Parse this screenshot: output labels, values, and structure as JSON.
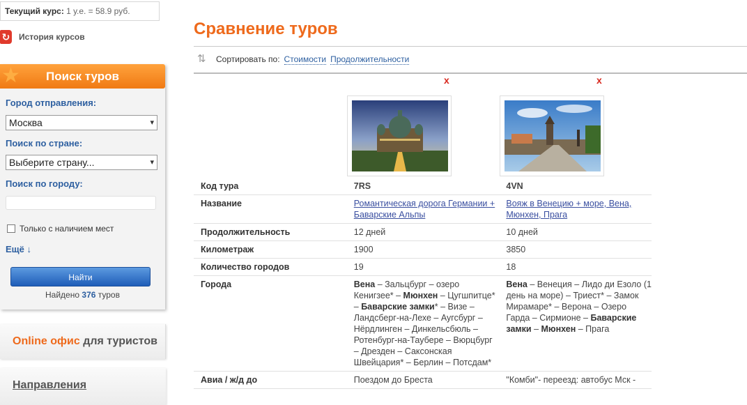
{
  "sidebar": {
    "rate_label": "Текущий курс:",
    "rate_value": "1 у.е. = 58.9 руб.",
    "history_label": "История курсов",
    "search": {
      "title": "Поиск туров",
      "departure_label": "Город отправления:",
      "departure_value": "Москва",
      "country_label": "Поиск по стране:",
      "country_value": "Выберите страну...",
      "city_label": "Поиск по городу:",
      "city_value": "",
      "only_available_label": "Только с наличием мест",
      "more_label": "Ещё ↓",
      "find_button": "Найти",
      "found_prefix": "Найдено",
      "found_count": "376",
      "found_suffix": "туров"
    },
    "online_part1": "Online офис",
    "online_part2": "для туристов",
    "directions_label": "Направления"
  },
  "main": {
    "title": "Сравнение туров",
    "sort_label": "Сортировать по:",
    "sort_options": [
      "Стоимости",
      "Продолжительности"
    ],
    "remove_label": "x",
    "rows": {
      "code": "Код тура",
      "name": "Название",
      "duration": "Продолжительность",
      "mileage": "Километраж",
      "cities_count": "Количество городов",
      "cities": "Города",
      "transport": "Авиа / ж/д до"
    },
    "tours": [
      {
        "code": "7RS",
        "name": "Романтическая дорога Германии + Баварские Альпы",
        "duration": "12 дней",
        "mileage": "1900",
        "cities_count": "19",
        "cities_1b": "Вена",
        "cities_2": " – Зальцбург – озеро Кенигзее* – ",
        "cities_3b": "Мюнхен",
        "cities_4": " – Цугшпитце* – ",
        "cities_5b": "Баварские замки",
        "cities_6": "* – Визе – Ландсберг-на-Лехе – Аугсбург – Нёрдлинген – Динкельсбюль – Ротенбург-на-Таубере – Вюрцбург – Дрезден – Саксонская Швейцария* – Берлин – Потсдам*",
        "transport": "Поездом до Бреста"
      },
      {
        "code": "4VN",
        "name": "Вояж в Венецию + море, Вена, Мюнхен, Прага",
        "duration": "10 дней",
        "mileage": "3850",
        "cities_count": "18",
        "cities_1b": "Вена",
        "cities_2": " – Венеция – Лидо ди Езоло (1 день на море) – Триест* – Замок Мирамаре* – Верона – Озеро Гарда – Сирмионе – ",
        "cities_3b": "Баварские замки",
        "cities_4": " – ",
        "cities_5b": "Мюнхен",
        "cities_6": " – Прага",
        "transport": "\"Комби\"- переезд: автобус Мск -"
      }
    ]
  }
}
